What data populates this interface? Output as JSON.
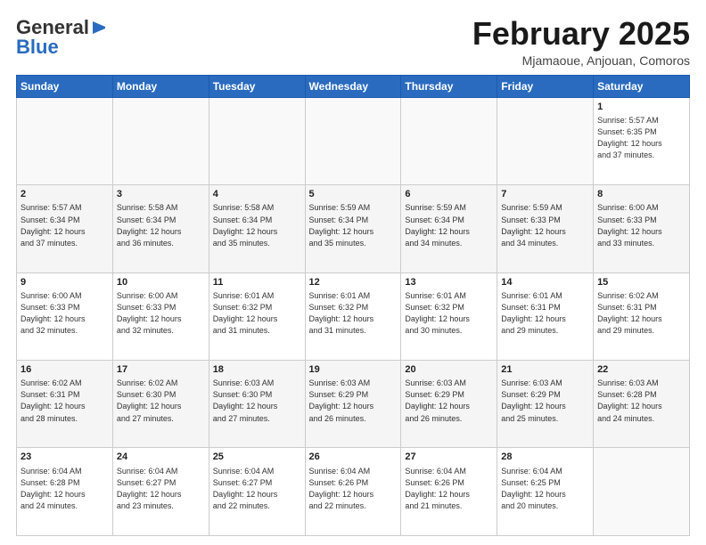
{
  "header": {
    "logo_general": "General",
    "logo_blue": "Blue",
    "month_title": "February 2025",
    "subtitle": "Mjamaoue, Anjouan, Comoros"
  },
  "weekdays": [
    "Sunday",
    "Monday",
    "Tuesday",
    "Wednesday",
    "Thursday",
    "Friday",
    "Saturday"
  ],
  "weeks": [
    [
      {
        "day": "",
        "info": ""
      },
      {
        "day": "",
        "info": ""
      },
      {
        "day": "",
        "info": ""
      },
      {
        "day": "",
        "info": ""
      },
      {
        "day": "",
        "info": ""
      },
      {
        "day": "",
        "info": ""
      },
      {
        "day": "1",
        "info": "Sunrise: 5:57 AM\nSunset: 6:35 PM\nDaylight: 12 hours\nand 37 minutes."
      }
    ],
    [
      {
        "day": "2",
        "info": "Sunrise: 5:57 AM\nSunset: 6:34 PM\nDaylight: 12 hours\nand 37 minutes."
      },
      {
        "day": "3",
        "info": "Sunrise: 5:58 AM\nSunset: 6:34 PM\nDaylight: 12 hours\nand 36 minutes."
      },
      {
        "day": "4",
        "info": "Sunrise: 5:58 AM\nSunset: 6:34 PM\nDaylight: 12 hours\nand 35 minutes."
      },
      {
        "day": "5",
        "info": "Sunrise: 5:59 AM\nSunset: 6:34 PM\nDaylight: 12 hours\nand 35 minutes."
      },
      {
        "day": "6",
        "info": "Sunrise: 5:59 AM\nSunset: 6:34 PM\nDaylight: 12 hours\nand 34 minutes."
      },
      {
        "day": "7",
        "info": "Sunrise: 5:59 AM\nSunset: 6:33 PM\nDaylight: 12 hours\nand 34 minutes."
      },
      {
        "day": "8",
        "info": "Sunrise: 6:00 AM\nSunset: 6:33 PM\nDaylight: 12 hours\nand 33 minutes."
      }
    ],
    [
      {
        "day": "9",
        "info": "Sunrise: 6:00 AM\nSunset: 6:33 PM\nDaylight: 12 hours\nand 32 minutes."
      },
      {
        "day": "10",
        "info": "Sunrise: 6:00 AM\nSunset: 6:33 PM\nDaylight: 12 hours\nand 32 minutes."
      },
      {
        "day": "11",
        "info": "Sunrise: 6:01 AM\nSunset: 6:32 PM\nDaylight: 12 hours\nand 31 minutes."
      },
      {
        "day": "12",
        "info": "Sunrise: 6:01 AM\nSunset: 6:32 PM\nDaylight: 12 hours\nand 31 minutes."
      },
      {
        "day": "13",
        "info": "Sunrise: 6:01 AM\nSunset: 6:32 PM\nDaylight: 12 hours\nand 30 minutes."
      },
      {
        "day": "14",
        "info": "Sunrise: 6:01 AM\nSunset: 6:31 PM\nDaylight: 12 hours\nand 29 minutes."
      },
      {
        "day": "15",
        "info": "Sunrise: 6:02 AM\nSunset: 6:31 PM\nDaylight: 12 hours\nand 29 minutes."
      }
    ],
    [
      {
        "day": "16",
        "info": "Sunrise: 6:02 AM\nSunset: 6:31 PM\nDaylight: 12 hours\nand 28 minutes."
      },
      {
        "day": "17",
        "info": "Sunrise: 6:02 AM\nSunset: 6:30 PM\nDaylight: 12 hours\nand 27 minutes."
      },
      {
        "day": "18",
        "info": "Sunrise: 6:03 AM\nSunset: 6:30 PM\nDaylight: 12 hours\nand 27 minutes."
      },
      {
        "day": "19",
        "info": "Sunrise: 6:03 AM\nSunset: 6:29 PM\nDaylight: 12 hours\nand 26 minutes."
      },
      {
        "day": "20",
        "info": "Sunrise: 6:03 AM\nSunset: 6:29 PM\nDaylight: 12 hours\nand 26 minutes."
      },
      {
        "day": "21",
        "info": "Sunrise: 6:03 AM\nSunset: 6:29 PM\nDaylight: 12 hours\nand 25 minutes."
      },
      {
        "day": "22",
        "info": "Sunrise: 6:03 AM\nSunset: 6:28 PM\nDaylight: 12 hours\nand 24 minutes."
      }
    ],
    [
      {
        "day": "23",
        "info": "Sunrise: 6:04 AM\nSunset: 6:28 PM\nDaylight: 12 hours\nand 24 minutes."
      },
      {
        "day": "24",
        "info": "Sunrise: 6:04 AM\nSunset: 6:27 PM\nDaylight: 12 hours\nand 23 minutes."
      },
      {
        "day": "25",
        "info": "Sunrise: 6:04 AM\nSunset: 6:27 PM\nDaylight: 12 hours\nand 22 minutes."
      },
      {
        "day": "26",
        "info": "Sunrise: 6:04 AM\nSunset: 6:26 PM\nDaylight: 12 hours\nand 22 minutes."
      },
      {
        "day": "27",
        "info": "Sunrise: 6:04 AM\nSunset: 6:26 PM\nDaylight: 12 hours\nand 21 minutes."
      },
      {
        "day": "28",
        "info": "Sunrise: 6:04 AM\nSunset: 6:25 PM\nDaylight: 12 hours\nand 20 minutes."
      },
      {
        "day": "",
        "info": ""
      }
    ]
  ]
}
